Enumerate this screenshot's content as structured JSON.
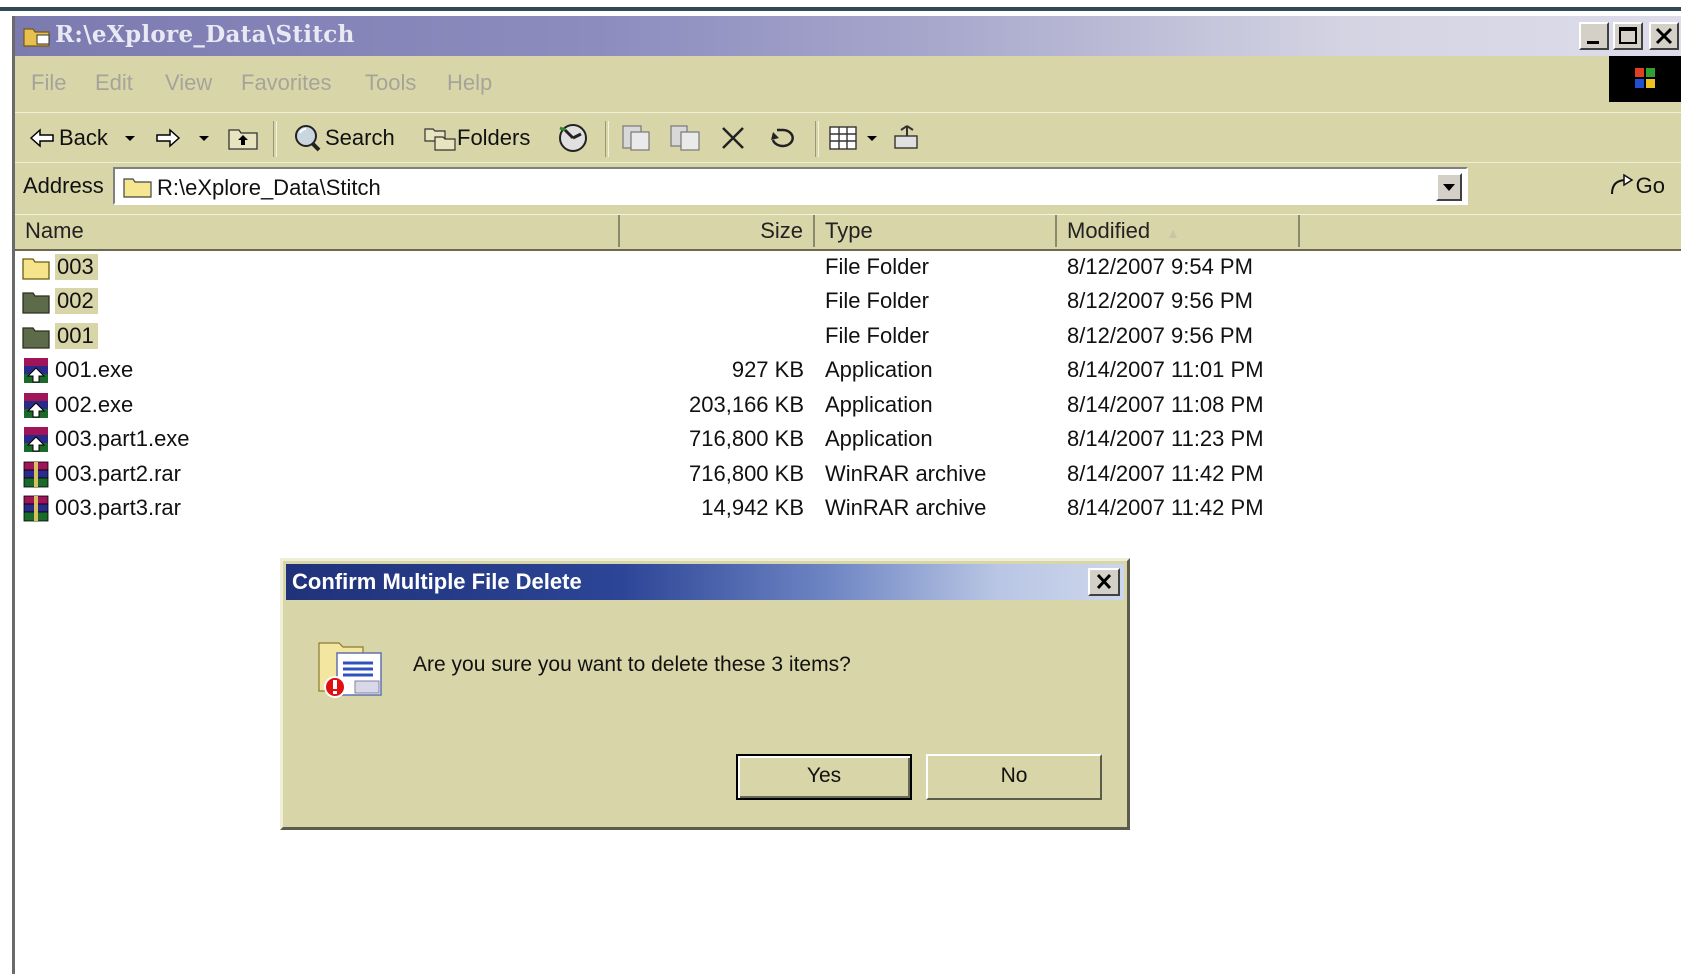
{
  "window": {
    "title": "R:\\eXplore_Data\\Stitch",
    "controls": [
      "minimize",
      "maximize",
      "close"
    ]
  },
  "menu": {
    "items": [
      "File",
      "Edit",
      "View",
      "Favorites",
      "Tools",
      "Help"
    ]
  },
  "toolbar": {
    "back_label": "Back",
    "search_label": "Search",
    "folders_label": "Folders"
  },
  "address": {
    "label": "Address",
    "path": "R:\\eXplore_Data\\Stitch",
    "go_label": "Go"
  },
  "columns": {
    "name": "Name",
    "size": "Size",
    "type": "Type",
    "modified": "Modified"
  },
  "files": [
    {
      "name": "003",
      "size": "",
      "type": "File Folder",
      "modified": "8/12/2007 9:54 PM",
      "icon": "folder-open-icon",
      "selected": true
    },
    {
      "name": "002",
      "size": "",
      "type": "File Folder",
      "modified": "8/12/2007 9:56 PM",
      "icon": "folder-icon",
      "selected": true
    },
    {
      "name": "001",
      "size": "",
      "type": "File Folder",
      "modified": "8/12/2007 9:56 PM",
      "icon": "folder-icon",
      "selected": true
    },
    {
      "name": "001.exe",
      "size": "927 KB",
      "type": "Application",
      "modified": "8/14/2007 11:01 PM",
      "icon": "winrar-sfx-icon",
      "selected": false
    },
    {
      "name": "002.exe",
      "size": "203,166 KB",
      "type": "Application",
      "modified": "8/14/2007 11:08 PM",
      "icon": "winrar-sfx-icon",
      "selected": false
    },
    {
      "name": "003.part1.exe",
      "size": "716,800 KB",
      "type": "Application",
      "modified": "8/14/2007 11:23 PM",
      "icon": "winrar-sfx-icon",
      "selected": false
    },
    {
      "name": "003.part2.rar",
      "size": "716,800 KB",
      "type": "WinRAR archive",
      "modified": "8/14/2007 11:42 PM",
      "icon": "winrar-archive-icon",
      "selected": false
    },
    {
      "name": "003.part3.rar",
      "size": "14,942 KB",
      "type": "WinRAR archive",
      "modified": "8/14/2007 11:42 PM",
      "icon": "winrar-archive-icon",
      "selected": false
    }
  ],
  "dialog": {
    "title": "Confirm Multiple File Delete",
    "message": "Are you sure you want to delete these 3 items?",
    "yes_label": "Yes",
    "no_label": "No"
  },
  "colors": {
    "chrome": "#d8d6a8",
    "title_active": "#20327a",
    "title_inactive": "#8c8cbf"
  }
}
